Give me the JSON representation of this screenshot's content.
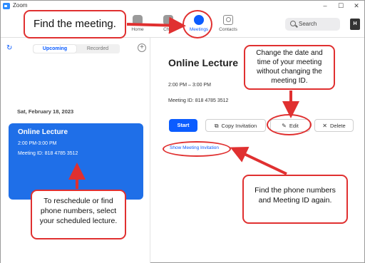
{
  "window": {
    "title": "Zoom",
    "minimize": "–",
    "maximize": "☐",
    "close": "✕"
  },
  "toolbar": {
    "tabs": [
      {
        "label": "Home",
        "icon": "home-icon"
      },
      {
        "label": "Chat",
        "icon": "chat-icon"
      },
      {
        "label": "Meetings",
        "icon": "clock-icon",
        "active": true
      },
      {
        "label": "Contacts",
        "icon": "contacts-icon"
      }
    ],
    "search_label": "Search",
    "avatar_initial": "H"
  },
  "left_pane": {
    "tabs": {
      "upcoming": "Upcoming",
      "recorded": "Recorded"
    },
    "date_header": "Sat, February 18, 2023",
    "meeting_card": {
      "title": "Online Lecture",
      "time": "2:00 PM-3:00 PM",
      "meeting_id": "Meeting ID: 818 4785 3512"
    }
  },
  "meeting_detail": {
    "title": "Online Lecture",
    "time": "2:00 PM – 3:00 PM",
    "meeting_id": "Meeting ID: 818 4785 3512",
    "buttons": {
      "start": "Start",
      "copy": "Copy Invitation",
      "edit": "Edit",
      "delete": "Delete"
    },
    "show_invitation": "Show Meeting Invitation"
  },
  "annotations": {
    "find_meeting": "Find the meeting.",
    "change_date": "Change the date and time of your meeting without changing the meeting ID.",
    "reschedule": "To reschedule or find phone numbers, select your scheduled lecture.",
    "find_phone": "Find the phone numbers and Meeting ID again."
  },
  "colors": {
    "accent": "#0b5cff",
    "card": "#1f6fe8",
    "annotation": "#e03030"
  }
}
